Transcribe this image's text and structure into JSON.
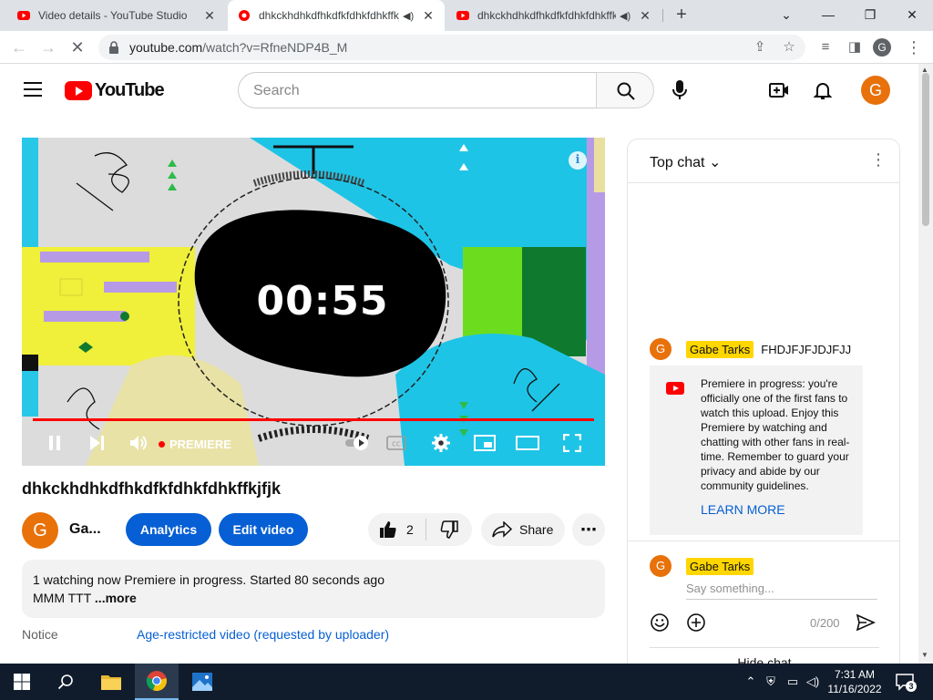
{
  "browser": {
    "tabs": [
      {
        "title": "Video details - YouTube Studio",
        "active": false
      },
      {
        "title": "dhkckhdhkdfhkdfkfdhkfdhkffkjfjk",
        "active": true
      },
      {
        "title": "dhkckhdhkdfhkdfkfdhkfdhkffkjfjk",
        "active": false
      }
    ],
    "url_host": "youtube.com",
    "url_path": "/watch?v=RfneNDP4B_M"
  },
  "masthead": {
    "logo_text": "YouTube",
    "search_placeholder": "Search",
    "avatar_letter": "G"
  },
  "player": {
    "countdown": "00:55",
    "status_label": "PREMIERE",
    "info_glyph": "i"
  },
  "video": {
    "title": "dhkckhdhkdfhkdfkfdhkfdhkffkjfjk",
    "owner_letter": "G",
    "owner_name": "Ga...",
    "analytics_label": "Analytics",
    "edit_label": "Edit video",
    "like_count": "2",
    "share_label": "Share"
  },
  "description": {
    "line1": "1 watching now  Premiere in progress. Started 80 seconds ago",
    "line2": "MMM TTT ",
    "more": "...more",
    "notice_key": "Notice",
    "notice_value": "Age-restricted video (requested by uploader)"
  },
  "chat": {
    "header": "Top chat",
    "message": {
      "avatar": "G",
      "author": "Gabe Tarks",
      "text": "FHDJFJFJDJFJJ"
    },
    "banner_text": "Premiere in progress: you're officially one of the first fans to watch this upload. Enjoy this Premiere by watching and chatting with other fans in real-time. Remember to guard your privacy and abide by our community guidelines.",
    "learn_more": "LEARN MORE",
    "input_author": "Gabe Tarks",
    "input_avatar": "G",
    "input_placeholder": "Say something...",
    "char_count": "0/200",
    "hide_chat": "Hide chat"
  },
  "taskbar": {
    "time": "7:31 AM",
    "date": "11/16/2022",
    "notification_count": "3"
  },
  "colors": {
    "brand_red": "#ff0000",
    "link_blue": "#065fd4",
    "avatar_orange": "#e8710a",
    "author_badge": "#ffd600"
  }
}
